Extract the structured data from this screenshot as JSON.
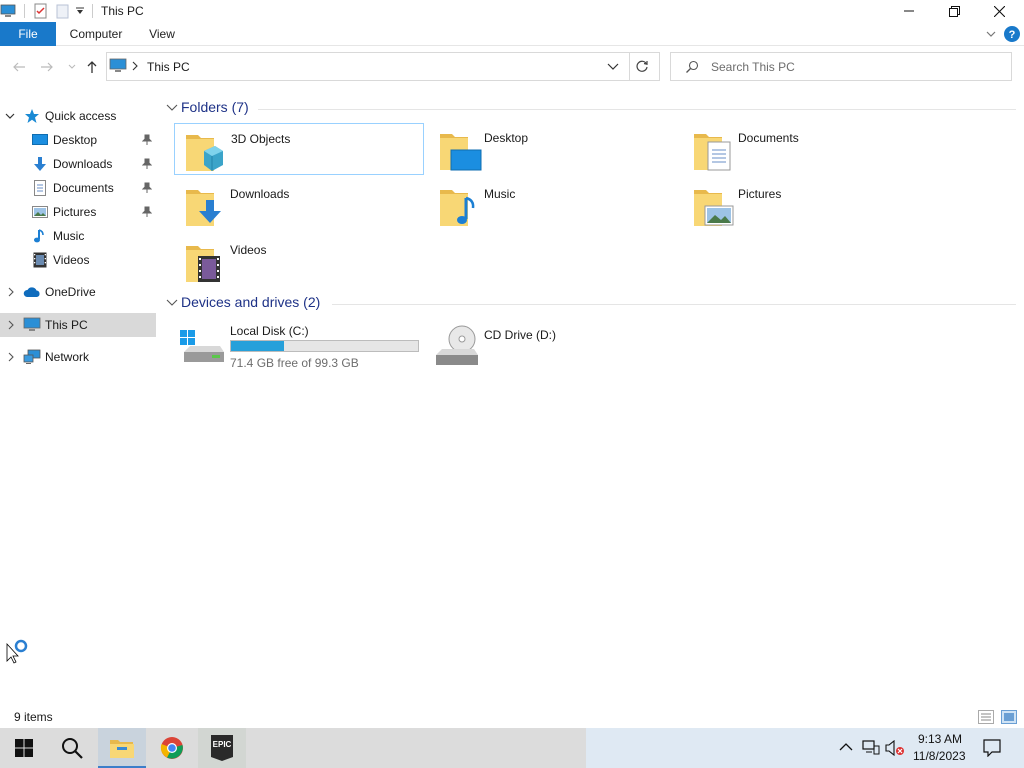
{
  "window": {
    "title": "This PC"
  },
  "ribbon": {
    "tabs": [
      "File",
      "Computer",
      "View"
    ]
  },
  "address": {
    "path": "This PC",
    "search_placeholder": "Search This PC"
  },
  "sidebar": {
    "quick_access": "Quick access",
    "quick_items": [
      {
        "label": "Desktop",
        "icon": "desktop-icon",
        "pinned": true
      },
      {
        "label": "Downloads",
        "icon": "downloads-icon",
        "pinned": true
      },
      {
        "label": "Documents",
        "icon": "documents-icon",
        "pinned": true
      },
      {
        "label": "Pictures",
        "icon": "pictures-icon",
        "pinned": true
      },
      {
        "label": "Music",
        "icon": "music-icon",
        "pinned": false
      },
      {
        "label": "Videos",
        "icon": "videos-icon",
        "pinned": false
      }
    ],
    "onedrive": "OneDrive",
    "thispc": "This PC",
    "network": "Network"
  },
  "main": {
    "folders_header": "Folders (7)",
    "folders": [
      {
        "name": "3D Objects",
        "icon": "3d-objects-icon"
      },
      {
        "name": "Desktop",
        "icon": "desktop-folder-icon"
      },
      {
        "name": "Documents",
        "icon": "documents-folder-icon"
      },
      {
        "name": "Downloads",
        "icon": "downloads-folder-icon"
      },
      {
        "name": "Music",
        "icon": "music-folder-icon"
      },
      {
        "name": "Pictures",
        "icon": "pictures-folder-icon"
      },
      {
        "name": "Videos",
        "icon": "videos-folder-icon"
      }
    ],
    "drives_header": "Devices and drives (2)",
    "drives": [
      {
        "name": "Local Disk (C:)",
        "free": "71.4 GB free of 99.3 GB",
        "used_fraction": 0.281
      },
      {
        "name": "CD Drive (D:)"
      }
    ]
  },
  "status": {
    "item_count": "9 items"
  },
  "taskbar": {
    "time": "9:13 AM",
    "date": "11/8/2023",
    "epic_label": "EPIC"
  },
  "colors": {
    "accent": "#1979ca",
    "selection_border": "#99d1ff",
    "sidebar_selected": "#d9d9d9",
    "group_header": "#1e3287",
    "folder_yellow": "#f8d775",
    "drive_bar": "#26a0da"
  }
}
